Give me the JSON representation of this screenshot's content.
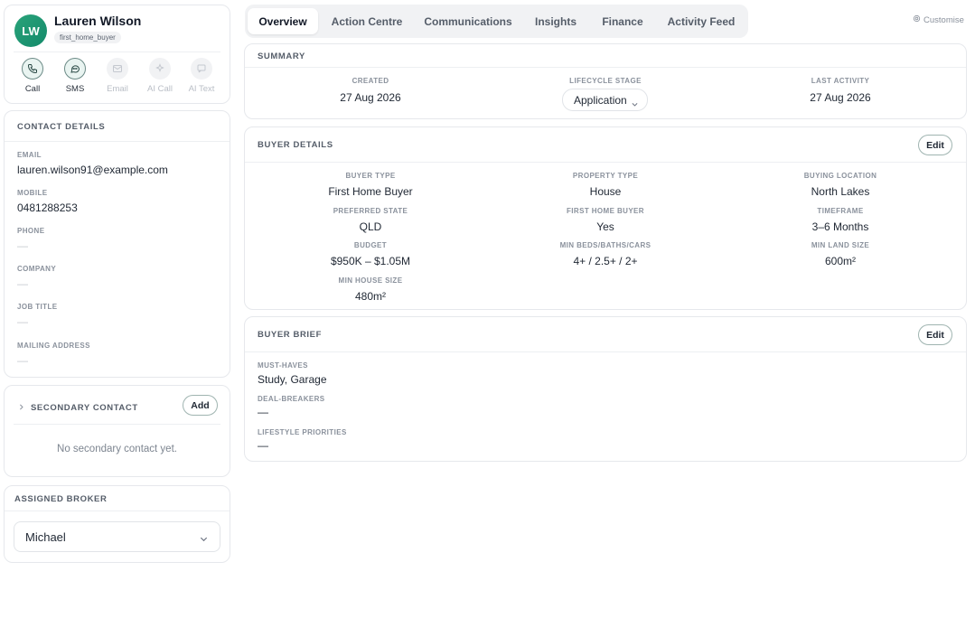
{
  "profile": {
    "initials": "LW",
    "name": "Lauren Wilson",
    "tag": "first_home_buyer",
    "actions": [
      {
        "label": "Call",
        "icon": "phone-icon",
        "enabled": true
      },
      {
        "label": "SMS",
        "icon": "message-icon",
        "enabled": true
      },
      {
        "label": "Email",
        "icon": "mail-icon",
        "enabled": false
      },
      {
        "label": "AI Call",
        "icon": "sparkle-icon",
        "enabled": false
      },
      {
        "label": "AI Text",
        "icon": "chat-icon",
        "enabled": false
      }
    ]
  },
  "contact": {
    "title": "CONTACT DETAILS",
    "fields": [
      {
        "label": "EMAIL",
        "value": "lauren.wilson91@example.com"
      },
      {
        "label": "MOBILE",
        "value": "0481288253"
      },
      {
        "label": "PHONE",
        "value": "—"
      },
      {
        "label": "COMPANY",
        "value": "—"
      },
      {
        "label": "JOB TITLE",
        "value": "—"
      },
      {
        "label": "MAILING ADDRESS",
        "value": "—"
      }
    ]
  },
  "secondary": {
    "title": "SECONDARY CONTACT",
    "add_label": "Add",
    "empty": "No secondary contact yet."
  },
  "broker": {
    "title": "ASSIGNED BROKER",
    "selected": "Michael"
  },
  "tabs": [
    "Overview",
    "Action Centre",
    "Communications",
    "Insights",
    "Finance",
    "Activity Feed"
  ],
  "active_tab": "Overview",
  "customise_label": "Customise",
  "summary": {
    "title": "SUMMARY",
    "created_label": "CREATED",
    "created": "27 Aug 2026",
    "stage_label": "LIFECYCLE STAGE",
    "stage": "Application",
    "last_label": "LAST ACTIVITY",
    "last": "27 Aug 2026"
  },
  "buyer": {
    "title": "BUYER DETAILS",
    "edit_label": "Edit",
    "fields": [
      {
        "label": "BUYER TYPE",
        "value": "First Home Buyer"
      },
      {
        "label": "PROPERTY TYPE",
        "value": "House"
      },
      {
        "label": "BUYING LOCATION",
        "value": "North Lakes"
      },
      {
        "label": "PREFERRED STATE",
        "value": "QLD"
      },
      {
        "label": "FIRST HOME BUYER",
        "value": "Yes"
      },
      {
        "label": "TIMEFRAME",
        "value": "3–6 Months"
      },
      {
        "label": "BUDGET",
        "value": "$950K – $1.05M"
      },
      {
        "label": "MIN BEDS/BATHS/CARS",
        "value": "4+ / 2.5+ / 2+"
      },
      {
        "label": "MIN LAND SIZE",
        "value": "600m²"
      },
      {
        "label": "MIN HOUSE SIZE",
        "value": "480m²"
      }
    ]
  },
  "brief": {
    "title": "BUYER BRIEF",
    "edit_label": "Edit",
    "fields": [
      {
        "label": "MUST-HAVES",
        "value": "Study, Garage"
      },
      {
        "label": "DEAL-BREAKERS",
        "value": "—"
      },
      {
        "label": "LIFESTYLE PRIORITIES",
        "value": "—"
      }
    ]
  },
  "colors": {
    "accent": "#1a9a72",
    "border": "#e6e8ec"
  }
}
